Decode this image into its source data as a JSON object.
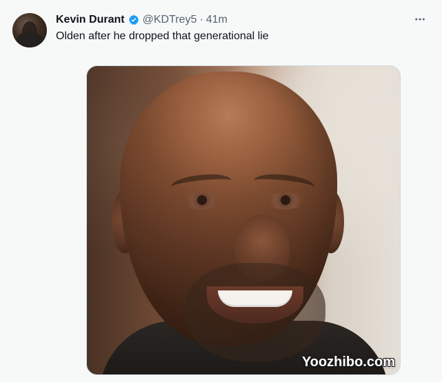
{
  "tweet": {
    "display_name": "Kevin Durant",
    "handle": "@KDTrey5",
    "separator": "·",
    "time": "41m",
    "text": "Olden after he dropped that generational lie",
    "watermark": "Yoozhibo.com",
    "icons": {
      "avatar": "user-avatar",
      "verified": "verified-badge-icon",
      "more": "more-icon"
    },
    "colors": {
      "verified": "#1d9bf0"
    }
  }
}
